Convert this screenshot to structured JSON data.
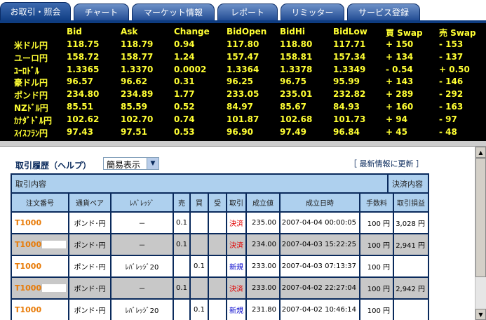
{
  "tabs": [
    {
      "label": "お取引・照会",
      "active": true
    },
    {
      "label": "チャート",
      "active": false
    },
    {
      "label": "マーケット情報",
      "active": false
    },
    {
      "label": "レポート",
      "active": false
    },
    {
      "label": "リミッター",
      "active": false
    },
    {
      "label": "サービス登録",
      "active": false
    }
  ],
  "rates": {
    "headers": [
      "Bid",
      "Ask",
      "Change",
      "BidOpen",
      "BidHi",
      "BidLow",
      "買 Swap",
      "売 Swap"
    ],
    "rows": [
      {
        "pair": "米ドル円",
        "values": [
          "118.75",
          "118.79",
          "0.94",
          "117.80",
          "118.80",
          "117.71",
          "+ 150",
          "- 153"
        ]
      },
      {
        "pair": "ユーロ円",
        "values": [
          "158.72",
          "158.77",
          "1.24",
          "157.47",
          "158.81",
          "157.34",
          "+ 134",
          "- 137"
        ]
      },
      {
        "pair": "ﾕｰﾛﾄﾞﾙ",
        "values": [
          "1.3365",
          "1.3370",
          "0.0002",
          "1.3364",
          "1.3378",
          "1.3349",
          "- 0.54",
          "+ 0.50"
        ]
      },
      {
        "pair": "豪ドル円",
        "values": [
          "96.57",
          "96.62",
          "0.31",
          "96.25",
          "96.75",
          "95.99",
          "+ 143",
          "- 146"
        ]
      },
      {
        "pair": "ポンド円",
        "values": [
          "234.80",
          "234.89",
          "1.77",
          "233.05",
          "235.01",
          "232.82",
          "+ 289",
          "- 292"
        ]
      },
      {
        "pair": "NZﾄﾞﾙ円",
        "values": [
          "85.51",
          "85.59",
          "0.52",
          "84.97",
          "85.67",
          "84.93",
          "+ 160",
          "- 163"
        ]
      },
      {
        "pair": "ｶﾅﾀﾞﾄﾞﾙ円",
        "values": [
          "102.62",
          "102.70",
          "0.74",
          "101.87",
          "102.68",
          "101.73",
          "+ 94",
          "- 97"
        ]
      },
      {
        "pair": "ｽｲｽﾌﾗﾝ円",
        "values": [
          "97.43",
          "97.51",
          "0.53",
          "96.90",
          "97.49",
          "96.84",
          "+ 45",
          "- 48"
        ]
      }
    ]
  },
  "history": {
    "title": "取引履歴（ヘルプ）",
    "display_mode": "簡易表示",
    "refresh_link": "［ 最新情報に更新 ］",
    "section_left": "取引内容",
    "section_right": "決済内容",
    "columns": [
      "注文番号",
      "通貨ペア",
      "ﾚﾊﾞﾚｯｼﾞ",
      "売",
      "買",
      "受",
      "取引",
      "成立値",
      "成立日時",
      "手数料",
      "取引損益"
    ],
    "rows": [
      {
        "order": "T1000",
        "pair": "ポンド･円",
        "leverage": "－",
        "sell": "0.1",
        "buy": "",
        "recv": "",
        "type": "決済",
        "price": "235.00",
        "datetime": "2007-04-04 00:00:05",
        "fee": "100 円",
        "pl": "3,028 円"
      },
      {
        "order": "T1000",
        "pair": "ポンド･円",
        "leverage": "－",
        "sell": "0.1",
        "buy": "",
        "recv": "",
        "type": "決済",
        "price": "234.00",
        "datetime": "2007-04-03 15:22:25",
        "fee": "100 円",
        "pl": "2,941 円"
      },
      {
        "order": "T1000",
        "pair": "ポンド･円",
        "leverage": "ﾚﾊﾞﾚｯｼﾞ20",
        "sell": "",
        "buy": "0.1",
        "recv": "",
        "type": "新規",
        "price": "233.00",
        "datetime": "2007-04-03 07:13:37",
        "fee": "100 円",
        "pl": ""
      },
      {
        "order": "T1000",
        "pair": "ポンド･円",
        "leverage": "－",
        "sell": "0.1",
        "buy": "",
        "recv": "",
        "type": "決済",
        "price": "233.00",
        "datetime": "2007-04-02 22:27:04",
        "fee": "100 円",
        "pl": "2,942 円"
      },
      {
        "order": "T1000",
        "pair": "ポンド･円",
        "leverage": "ﾚﾊﾞﾚｯｼﾞ20",
        "sell": "",
        "buy": "0.1",
        "recv": "",
        "type": "新規",
        "price": "231.80",
        "datetime": "2007-04-02 10:46:14",
        "fee": "100 円",
        "pl": ""
      }
    ]
  },
  "colors": {
    "tab_bg": "#224c94",
    "rates_bg": "#000000",
    "rates_text": "#ffff33",
    "header_cell": "#aed0ee",
    "order_id": "#e87b08",
    "settle": "#e00000",
    "new": "#0000cc"
  }
}
